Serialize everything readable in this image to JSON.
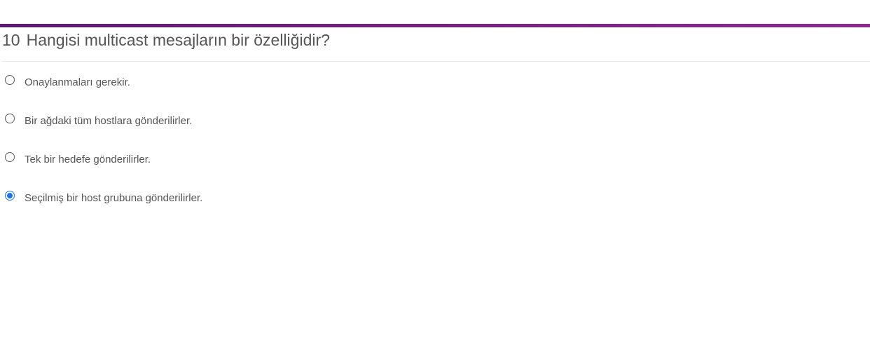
{
  "question": {
    "number": "10",
    "text": "Hangisi multicast mesajların bir özelliğidir?"
  },
  "options": [
    {
      "label": "Onaylanmaları gerekir.",
      "selected": false
    },
    {
      "label": "Bir ağdaki tüm hostlara gönderilirler.",
      "selected": false
    },
    {
      "label": "Tek bir hedefe gönderilirler.",
      "selected": false
    },
    {
      "label": "Seçilmiş bir host grubuna gönderilirler.",
      "selected": true
    }
  ],
  "colors": {
    "accent_start": "#5b1a6e",
    "accent_end": "#8e2a8f",
    "radio_selected": "#1a73e8",
    "text": "#555555"
  }
}
